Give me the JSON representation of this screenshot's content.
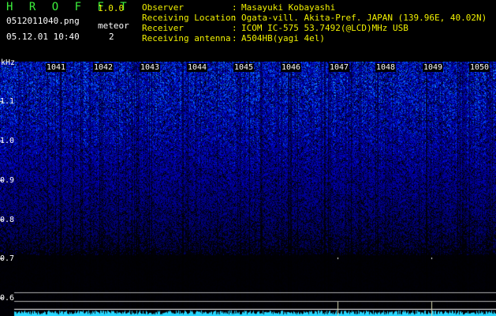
{
  "header": {
    "app_title": "H R O F F T",
    "version": "1.0.0",
    "filename": "0512011040.png",
    "datetime": "05.12.01 10:40",
    "meteor_label": "meteor",
    "meteor_count": "2",
    "info": [
      {
        "label": "Observer",
        "value": "Masayuki Kobayashi"
      },
      {
        "label": "Receiving Location",
        "value": "Ogata-vill. Akita-Pref. JAPAN (139.96E, 40.02N)"
      },
      {
        "label": "Receiver",
        "value": "ICOM IC-575 53.7492(@LCD)MHz USB"
      },
      {
        "label": "Receiving antenna",
        "value": "A504HB(yagi 4el)"
      }
    ],
    "info_separator": ":"
  },
  "spectrogram": {
    "freq_unit": "kHz",
    "y_ticks": [
      "1.1",
      "1.0",
      "0.9",
      "0.8",
      "0.7",
      "0.6"
    ],
    "x_ticks": [
      "1041",
      "1042",
      "1043",
      "1044",
      "1045",
      "1046",
      "1047",
      "1048",
      "1049",
      "1050"
    ],
    "meteor_echoes": [
      {
        "time": "1047",
        "freq_khz": 0.7
      },
      {
        "time": "1049",
        "freq_khz": 0.7
      }
    ]
  },
  "colors": {
    "background": "#000000",
    "title_green": "#3cf03c",
    "info_yellow": "#f0f000",
    "signal_blue": "#1a3cff",
    "signal_cyan": "#28d7ff",
    "grid_line": "#b0b0b0"
  }
}
